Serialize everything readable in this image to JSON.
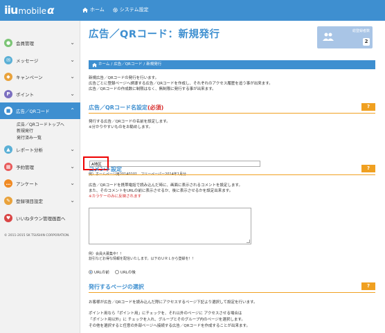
{
  "app": {
    "logo_mark": "iiu",
    "logo_word": "mobile",
    "logo_alpha": "α",
    "nav": [
      {
        "label": "ホーム",
        "icon": "home-icon"
      },
      {
        "label": "システム設定",
        "icon": "gear-icon"
      }
    ]
  },
  "sidebar": {
    "items": [
      {
        "label": "会員管理",
        "icon": "user-icon",
        "color": "#7cc576",
        "glyph": "●"
      },
      {
        "label": "メッセージ",
        "icon": "mail-icon",
        "color": "#5bb0d6",
        "glyph": "✉"
      },
      {
        "label": "キャンペーン",
        "icon": "campaign-icon",
        "color": "#e9a23b",
        "glyph": "◆"
      },
      {
        "label": "ポイント",
        "icon": "point-icon",
        "color": "#7b6fc0",
        "glyph": "P"
      },
      {
        "label": "広告／QRコード",
        "icon": "qr-icon",
        "color": "#ffffff",
        "glyph": "■"
      },
      {
        "label": "レポート分析",
        "icon": "report-icon",
        "color": "#5bb0d6",
        "glyph": "▲"
      },
      {
        "label": "予約管理",
        "icon": "calendar-icon",
        "color": "#e85a5a",
        "glyph": "▦"
      },
      {
        "label": "アンケート",
        "icon": "survey-icon",
        "color": "#f08a24",
        "glyph": "…"
      },
      {
        "label": "登録項目設定",
        "icon": "settings-icon",
        "color": "#e9a23b",
        "glyph": "✎"
      },
      {
        "label": "いいねタウン管理画面へ",
        "icon": "town-icon",
        "color": "#d94646",
        "glyph": "♥"
      }
    ],
    "sub_items": [
      "広告／QRコードトップへ",
      "新規発行",
      "発行済み一覧"
    ],
    "copyright": "© 2011-2015 SK TSUSHIN CORPORATION."
  },
  "main": {
    "title": "広告／QRコード：新規発行",
    "count_label": "総登録者数",
    "count_value": "2",
    "breadcrumb": [
      "ホーム",
      "広告／QRコード",
      "新規発行"
    ],
    "intro": [
      "新規広告／QRコードの発行を行います。",
      "広告ごとに登録ページへ誘導する広告／QRコードを作成し、それぞれのアクセス履歴を追う事が出来ます。",
      "広告／QRコードの作成数に制限はなく、無制限に発行する事が出来ます。"
    ],
    "section_name": {
      "title": "広告／QRコード名設定",
      "required": "(必須)",
      "help": "?",
      "lines": [
        "発行する広告／QRコードの名前を設定します。",
        "※分かりやすいものをお勧めします。"
      ],
      "input_value": "A地区",
      "example": "例）ホームページ用20140101　フリーペーパー2014年1月分"
    },
    "section_comment": {
      "title": "コメント設定",
      "help": "?",
      "lines": [
        "広告／QRコードを携帯電話で読み込んだ時に、画面に表示されるコメントを設定します。",
        "また、そのコメントをURLの前に表示させるか、後に表示させるかを設定出来ます。"
      ],
      "note": "※カラケーのみに反映されます",
      "example_lines": [
        "例）会員大募集中！！",
        "割引などお得な情報を配信いたします。以下のＵＲＬから登録を！！"
      ],
      "radio_options": [
        "URLの前",
        "URLの後"
      ]
    },
    "section_page": {
      "title": "発行するページの選択",
      "help": "?",
      "lines": [
        "お客様が広告／QRコードを読み込んだ際にアクセスするページ下記より選択して設定を行います。",
        "",
        "ポイント用なら「ポイント用」にチェックを、それ以外のページに アクセスさせる場合は",
        "「ポイント用以外」に チェックを入れ、グループとそのグループ内のページを選択します。",
        "その他を選択すると任意の外部ページへ接続する広告／QRコードを作成することが出来ます。"
      ]
    }
  }
}
